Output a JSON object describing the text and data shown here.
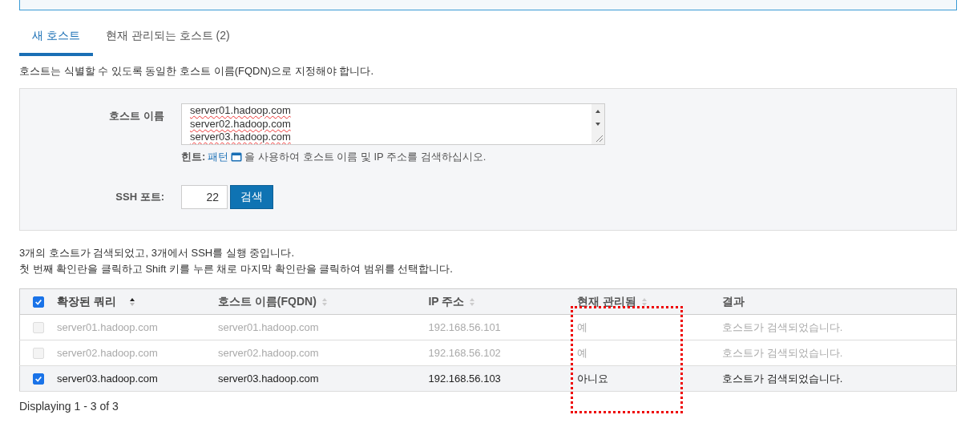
{
  "tabs": [
    {
      "label": "새 호스트",
      "selected": true
    },
    {
      "label": "현재 관리되는 호스트 (2)",
      "selected": false
    }
  ],
  "description": "호스트는 식별할 수 있도록 동일한 호스트 이름(FQDN)으로 지정해야 합니다.",
  "form": {
    "hostname_label": "호스트 이름",
    "hostnames": [
      "server01.hadoop.com",
      "server02.hadoop.com",
      "server03.hadoop.com"
    ],
    "hint": {
      "label": "힌트:",
      "link": "패턴",
      "text": "을 사용하여 호스트 이름 및 IP 주소를 검색하십시오."
    },
    "ssh_label": "SSH 포트:",
    "ssh_port": "22",
    "search_button": "검색"
  },
  "messages": [
    "3개의 호스트가 검색되었고, 3개에서 SSH를 실행 중입니다.",
    "첫 번째 확인란을 클릭하고 Shift 키를 누른 채로 마지막 확인란을 클릭하여 범위를 선택합니다."
  ],
  "table": {
    "all_checked": true,
    "columns": [
      {
        "label": "확장된 쿼리",
        "sortable": true,
        "sorted": true
      },
      {
        "label": "호스트 이름(FQDN)",
        "sortable": true,
        "sorted": false
      },
      {
        "label": "IP 주소",
        "sortable": true,
        "sorted": false
      },
      {
        "label": "현재 관리됨",
        "sortable": true,
        "sorted": false
      },
      {
        "label": "결과",
        "sortable": false,
        "sorted": false
      }
    ],
    "rows": [
      {
        "checked": false,
        "disabled": true,
        "cells": [
          "server01.hadoop.com",
          "server01.hadoop.com",
          "192.168.56.101",
          "예",
          "호스트가 검색되었습니다."
        ]
      },
      {
        "checked": false,
        "disabled": true,
        "cells": [
          "server02.hadoop.com",
          "server02.hadoop.com",
          "192.168.56.102",
          "예",
          "호스트가 검색되었습니다."
        ]
      },
      {
        "checked": true,
        "disabled": false,
        "cells": [
          "server03.hadoop.com",
          "server03.hadoop.com",
          "192.168.56.103",
          "아니요",
          "호스트가 검색되었습니다."
        ]
      }
    ]
  },
  "footer": "Displaying 1 - 3 of 3"
}
